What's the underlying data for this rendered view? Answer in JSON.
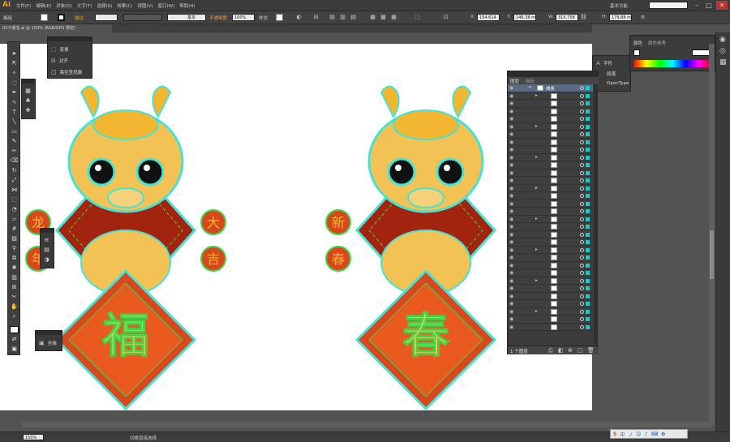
{
  "app": {
    "logo": "Ai",
    "workspace": "基本功能"
  },
  "menus": [
    "文件(F)",
    "编辑(E)",
    "对象(O)",
    "文字(T)",
    "选择(S)",
    "效果(C)",
    "视图(V)",
    "窗口(W)",
    "帮助(H)"
  ],
  "control_bar": {
    "selection": "编组",
    "stroke_label": "描边",
    "stroke_style": "基本",
    "opacity_label": "不透明度",
    "opacity_value": "100%",
    "style_label": "样式",
    "x_value": "154.614",
    "y_value": "146.38 m",
    "w_value": "315.758",
    "h_value": "179.88 m"
  },
  "document": {
    "tab_title": "02卡通龙.ai @ 150% (RGB/GPU 预览)"
  },
  "flyout": {
    "items": [
      {
        "icon": "transform-icon",
        "label": "变换"
      },
      {
        "icon": "align-icon",
        "label": "对齐"
      },
      {
        "icon": "pathfinder-icon",
        "label": "路径查找器"
      }
    ]
  },
  "flyout_small": {
    "label": "全端"
  },
  "type_panel": {
    "items": [
      "字符",
      "段落",
      "OpenType"
    ]
  },
  "color_panel": {
    "tabs": [
      "颜色",
      "颜色参考"
    ]
  },
  "layers": {
    "tabs": [
      "图层",
      "画板"
    ],
    "top_layer": "线条",
    "footer": "1 个图层",
    "rows": 32
  },
  "artwork": {
    "left_center_char": "福",
    "right_center_char": "春",
    "left_badges": [
      "龙",
      "年"
    ],
    "right_badges_left": [
      "大",
      "吉"
    ],
    "right_art_badges": [
      "新",
      "春"
    ]
  },
  "status": {
    "zoom": "150%",
    "tool_name": "切换直接选择"
  },
  "colors": {
    "outline_cyan": "#45e3d4",
    "guide_green": "#3cd64a",
    "dragon_yellow": "#f2b630",
    "red_body": "#d9481c",
    "dark_red": "#a3240e",
    "ui_dark": "#3c3c3c"
  }
}
